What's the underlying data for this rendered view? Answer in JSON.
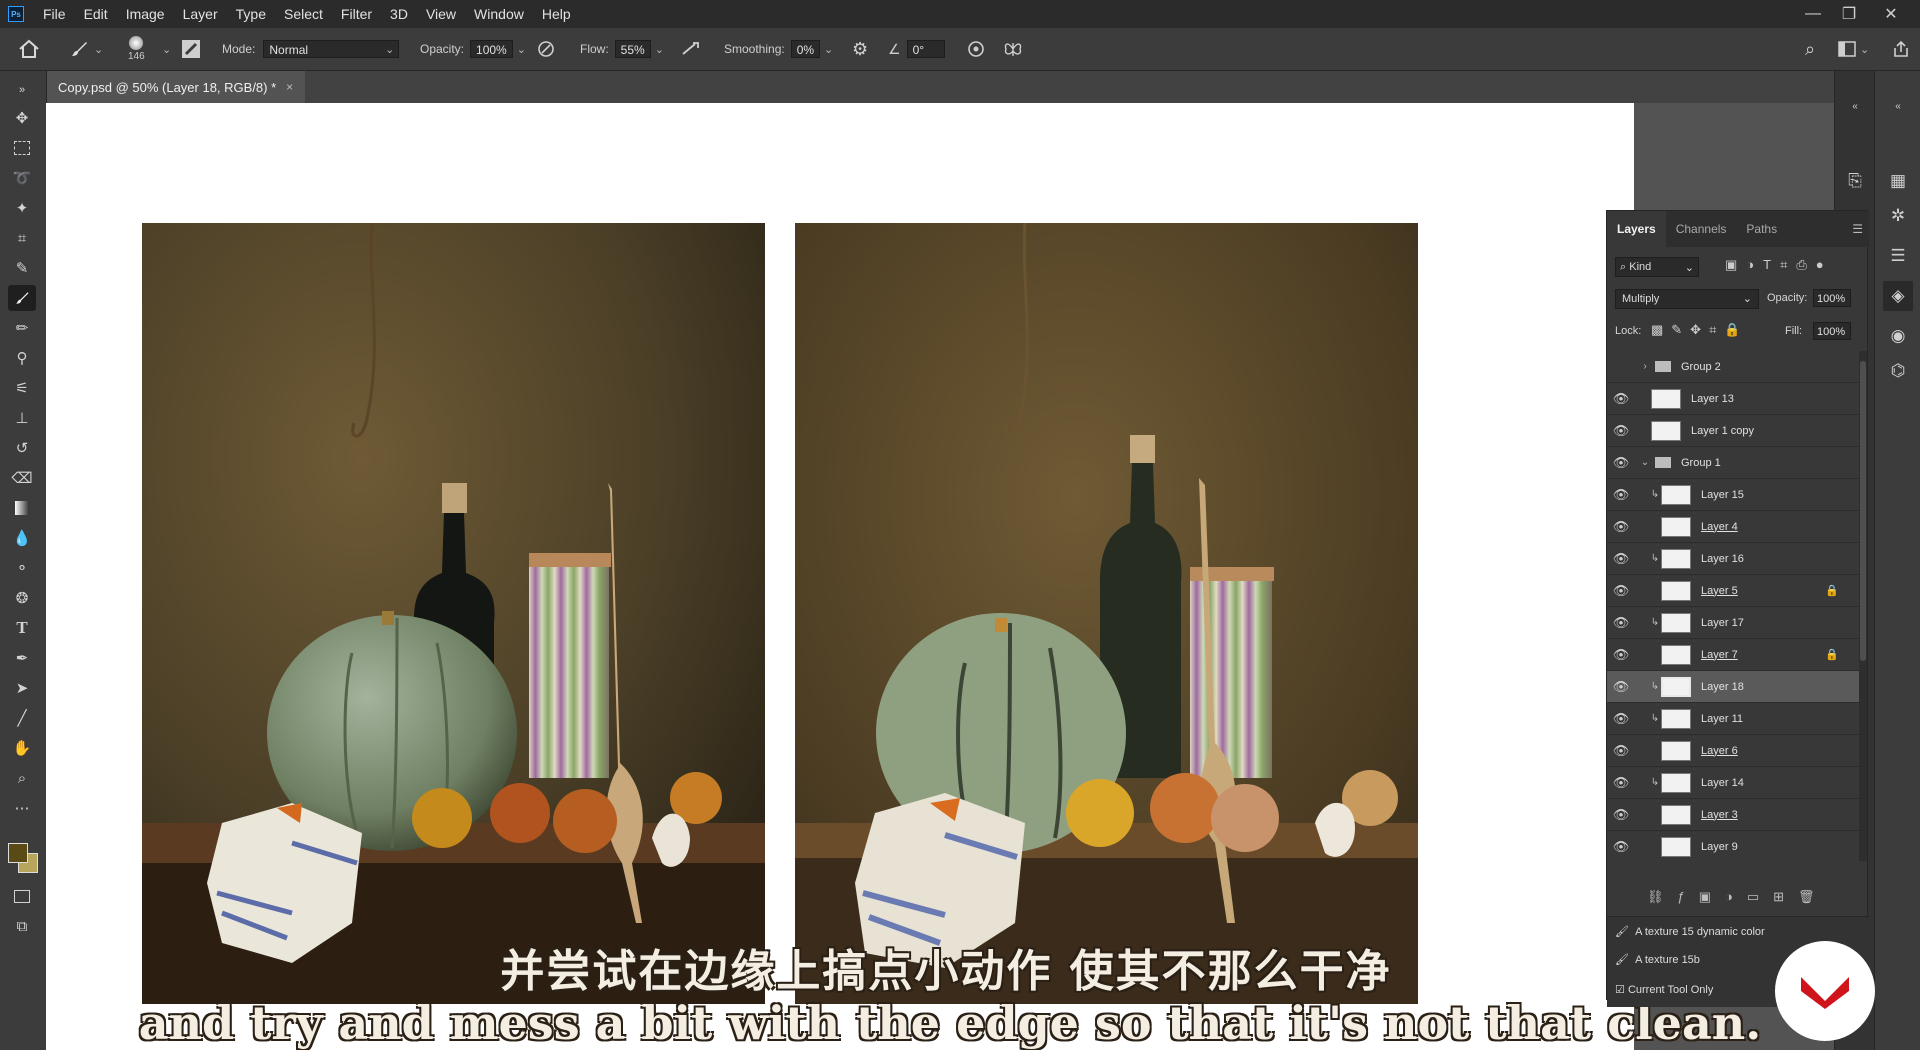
{
  "app": {
    "logo": "Ps"
  },
  "menu": [
    "File",
    "Edit",
    "Image",
    "Layer",
    "Type",
    "Select",
    "Filter",
    "3D",
    "View",
    "Window",
    "Help"
  ],
  "window_controls": {
    "minimize": "—",
    "restore": "❐",
    "close": "✕"
  },
  "options": {
    "brush_size": "146",
    "mode_label": "Mode:",
    "mode_value": "Normal",
    "opacity_label": "Opacity:",
    "opacity_value": "100%",
    "flow_label": "Flow:",
    "flow_value": "55%",
    "smoothing_label": "Smoothing:",
    "smoothing_value": "0%",
    "angle_value": "0°"
  },
  "document_tab": {
    "title": "Copy.psd @ 50% (Layer 18, RGB/8) *",
    "close": "×"
  },
  "subtitles": {
    "chinese": "并尝试在边缘上搞点小动作 使其不那么干净",
    "english": "and try and mess a bit with the edge so that it's not that clean."
  },
  "layers_panel": {
    "tabs": [
      "Layers",
      "Channels",
      "Paths"
    ],
    "filter_kind": "Kind",
    "blend_mode": "Multiply",
    "opacity_label": "Opacity:",
    "opacity_value": "100%",
    "lock_label": "Lock:",
    "fill_label": "Fill:",
    "fill_value": "100%",
    "layers": [
      {
        "name": "Group 2",
        "type": "group",
        "visible": false,
        "expanded": false
      },
      {
        "name": "Layer 13",
        "visible": true
      },
      {
        "name": "Layer 1 copy",
        "visible": true
      },
      {
        "name": "Group 1",
        "type": "group",
        "visible": true,
        "expanded": true
      },
      {
        "name": "Layer 15",
        "visible": true,
        "clipped": true
      },
      {
        "name": "Layer 4",
        "visible": true,
        "underlined": true
      },
      {
        "name": "Layer 16",
        "visible": true,
        "clipped": true
      },
      {
        "name": "Layer 5",
        "visible": true,
        "underlined": true,
        "locked": true
      },
      {
        "name": "Layer 17",
        "visible": true,
        "clipped": true
      },
      {
        "name": "Layer 7",
        "visible": true,
        "underlined": true,
        "locked": true
      },
      {
        "name": "Layer 18",
        "visible": true,
        "clipped": true,
        "selected": true
      },
      {
        "name": "Layer 11",
        "visible": true,
        "clipped": true
      },
      {
        "name": "Layer 6",
        "visible": true,
        "underlined": true
      },
      {
        "name": "Layer 14",
        "visible": true,
        "clipped": true
      },
      {
        "name": "Layer 3",
        "visible": true,
        "underlined": true
      },
      {
        "name": "Layer 9",
        "visible": true
      }
    ]
  },
  "tool_presets": {
    "items": [
      "A texture 15 dynamic color",
      "A texture 15b"
    ],
    "current_tool_only": "Current Tool Only"
  },
  "colors": {
    "foreground": "#5a4a16",
    "background": "#b8a55c",
    "accent_red": "#d0141c"
  }
}
